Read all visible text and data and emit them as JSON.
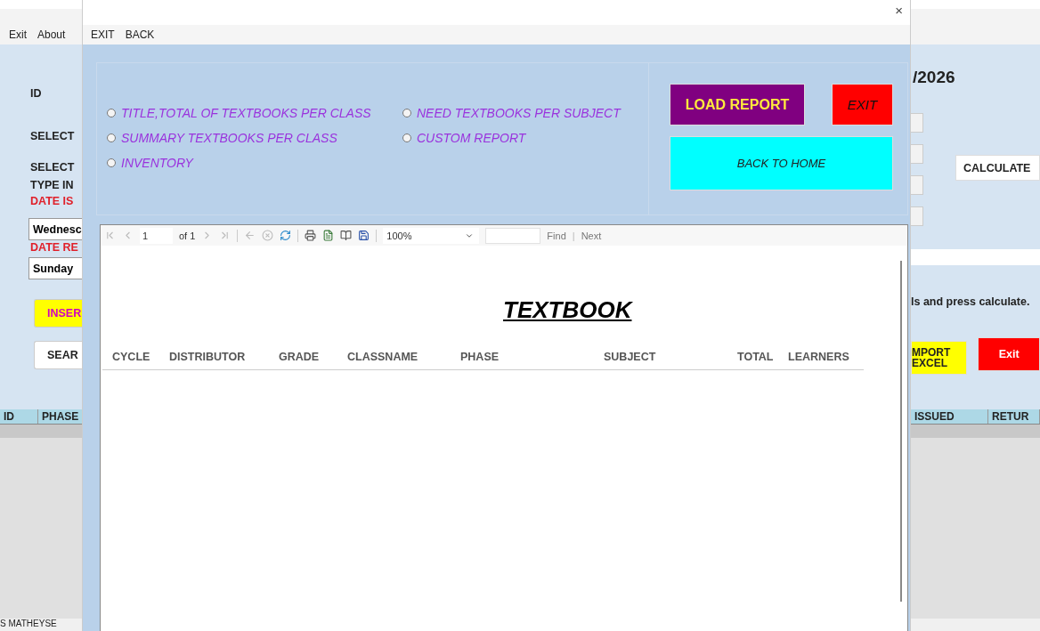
{
  "main_window": {
    "menu": [
      {
        "label": "Exit"
      },
      {
        "label": "About"
      }
    ],
    "left_items": [
      {
        "kind": "label",
        "text": "ID"
      },
      {
        "kind": "label",
        "text": "SELECT"
      },
      {
        "kind": "label",
        "text": "SELECT"
      },
      {
        "kind": "label",
        "text": "TYPE IN"
      },
      {
        "kind": "alert",
        "text": "DATE IS"
      },
      {
        "kind": "field",
        "text": "Wednesc"
      },
      {
        "kind": "alert",
        "text": "DATE RE"
      },
      {
        "kind": "field",
        "text": "Sunday"
      },
      {
        "kind": "insert",
        "text": "INSER"
      },
      {
        "kind": "plain",
        "text": "SEAR"
      }
    ],
    "date_text": "/2026",
    "calculate_button": "CALCULATE",
    "hint": "ls and press calculate.",
    "import_button": [
      "MPORT",
      "EXCEL"
    ],
    "exit_button": "Exit",
    "grid_left_columns": [
      "ID",
      "PHASE"
    ],
    "grid_right_columns": [
      "ISSUED",
      "RETUR"
    ],
    "status": "S MATHEYSE"
  },
  "dialog": {
    "close": "×",
    "menu": [
      {
        "label": "EXIT"
      },
      {
        "label": "BACK"
      }
    ],
    "report_options": [
      {
        "label": "TITLE,TOTAL OF TEXTBOOKS PER CLASS",
        "selected": false
      },
      {
        "label": "NEED TEXTBOOKS PER SUBJECT",
        "selected": false
      },
      {
        "label": "SUMMARY TEXTBOOKS PER CLASS",
        "selected": false
      },
      {
        "label": "CUSTOM REPORT",
        "selected": false
      },
      {
        "label": "INVENTORY",
        "selected": false
      }
    ],
    "buttons": [
      {
        "kind": "load",
        "label": "LOAD REPORT"
      },
      {
        "kind": "exit",
        "label": "EXIT"
      },
      {
        "kind": "home",
        "label": "BACK TO HOME"
      }
    ],
    "viewer": {
      "page": "1",
      "page_count": "of 1",
      "zoom": "100%",
      "find": "Find",
      "separator": "|",
      "next": "Next",
      "report_title": "TEXTBOOK",
      "columns": [
        "CYCLE",
        "DISTRIBUTOR",
        "GRADE",
        "CLASSNAME",
        "PHASE",
        "SUBJECT",
        "TOTAL",
        "LEARNERS"
      ]
    }
  }
}
